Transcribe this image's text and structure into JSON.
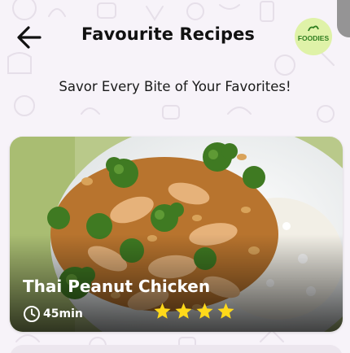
{
  "header": {
    "title": "Favourite Recipes",
    "back_icon": "arrow-left-icon",
    "logo_text": "FOODIES"
  },
  "tagline": "Savor Every Bite of Your Favorites!",
  "recipes": [
    {
      "name": "Thai Peanut Chicken",
      "time": "45min",
      "rating": 4,
      "time_icon": "clock-icon",
      "rating_icon": "star-icon"
    }
  ],
  "colors": {
    "background": "#f7f3f9",
    "star": "#ffd91a",
    "logo_bg": "#dff2a8",
    "logo_text": "#2e7d1f"
  }
}
